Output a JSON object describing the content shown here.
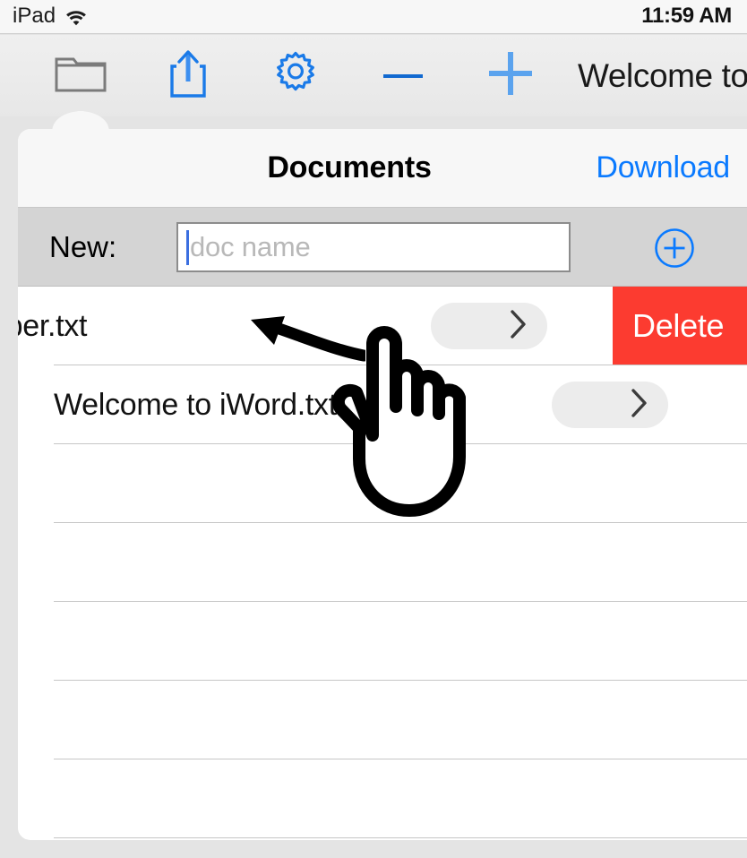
{
  "statusbar": {
    "carrier": "iPad",
    "wifi_icon": "wifi-icon",
    "time": "11:59 AM"
  },
  "toolbar": {
    "items": [
      {
        "name": "folder-icon",
        "label": "Documents",
        "state": "selected",
        "color": "#7a7a7a"
      },
      {
        "name": "share-icon",
        "label": "Share",
        "state": "normal",
        "color": "#1a7ae8"
      },
      {
        "name": "gear-icon",
        "label": "Settings",
        "state": "normal",
        "color": "#1a7ae8"
      },
      {
        "name": "minus-icon",
        "label": "Zoom Out",
        "state": "normal",
        "color": "#1169d0"
      },
      {
        "name": "plus-icon",
        "label": "Zoom In",
        "state": "normal",
        "color": "#5ba3ee"
      }
    ],
    "document_title": "Welcome to"
  },
  "popover": {
    "title": "Documents",
    "action_label": "Download",
    "new_row": {
      "label": "New:",
      "input_value": "",
      "placeholder": "doc name",
      "add_icon": "plus-circle-icon"
    },
    "rows": [
      {
        "name": "aper.txt",
        "clipped": true,
        "swiped": true,
        "chevron_icon": "chevron-right-icon",
        "delete_label": "Delete"
      },
      {
        "name": "Welcome to iWord.txt",
        "clipped": false,
        "swiped": false,
        "chevron_icon": "chevron-right-icon",
        "delete_label": ""
      },
      {
        "name": "",
        "clipped": false,
        "swiped": false,
        "chevron_icon": "",
        "delete_label": ""
      },
      {
        "name": "",
        "clipped": false,
        "swiped": false,
        "chevron_icon": "",
        "delete_label": ""
      },
      {
        "name": "",
        "clipped": false,
        "swiped": false,
        "chevron_icon": "",
        "delete_label": ""
      },
      {
        "name": "",
        "clipped": false,
        "swiped": false,
        "chevron_icon": "",
        "delete_label": ""
      },
      {
        "name": "",
        "clipped": false,
        "swiped": false,
        "chevron_icon": "",
        "delete_label": ""
      }
    ]
  },
  "annotations": {
    "swipe_arrow_icon": "left-arrow-annotation",
    "hand_cursor_icon": "pointing-hand-cursor"
  },
  "colors": {
    "accent_blue": "#0a7aff",
    "delete_red": "#fc3b30",
    "toolbar_bg": "#ebebeb",
    "new_row_bg": "#d4d4d4"
  }
}
